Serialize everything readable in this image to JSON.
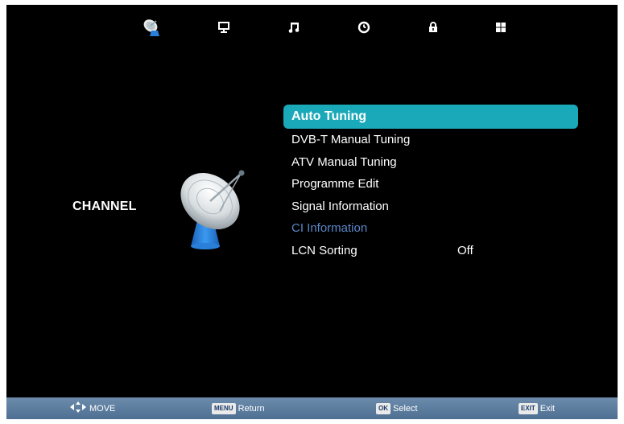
{
  "tabs": [
    {
      "icon": "satellite-dish-icon",
      "name": "channel",
      "active": true
    },
    {
      "icon": "monitor-icon",
      "name": "picture",
      "active": false
    },
    {
      "icon": "music-note-icon",
      "name": "sound",
      "active": false
    },
    {
      "icon": "clock-icon",
      "name": "time",
      "active": false
    },
    {
      "icon": "lock-icon",
      "name": "lock",
      "active": false
    },
    {
      "icon": "grid-icon",
      "name": "setup",
      "active": false
    }
  ],
  "section": {
    "title": "CHANNEL",
    "image_icon": "satellite-dish-icon"
  },
  "menu": {
    "items": [
      {
        "label": "Auto Tuning",
        "state": "selected"
      },
      {
        "label": "DVB-T Manual Tuning",
        "state": "normal"
      },
      {
        "label": "ATV Manual Tuning",
        "state": "normal"
      },
      {
        "label": "Programme Edit",
        "state": "normal"
      },
      {
        "label": "Signal Information",
        "state": "normal"
      },
      {
        "label": "CI Information",
        "state": "disabled"
      },
      {
        "label": "LCN Sorting",
        "state": "normal",
        "value": "Off"
      }
    ]
  },
  "help": {
    "move": {
      "icon": "move-arrows-icon",
      "label": "MOVE"
    },
    "return": {
      "key": "MENU",
      "label": "Return"
    },
    "select": {
      "key": "OK",
      "label": "Select"
    },
    "exit": {
      "key": "EXIT",
      "label": "Exit"
    }
  },
  "colors": {
    "background": "#000000",
    "highlight": "#1aa9b8",
    "disabled_text": "#5a86c8",
    "helpbar": "#5d7d9f"
  }
}
